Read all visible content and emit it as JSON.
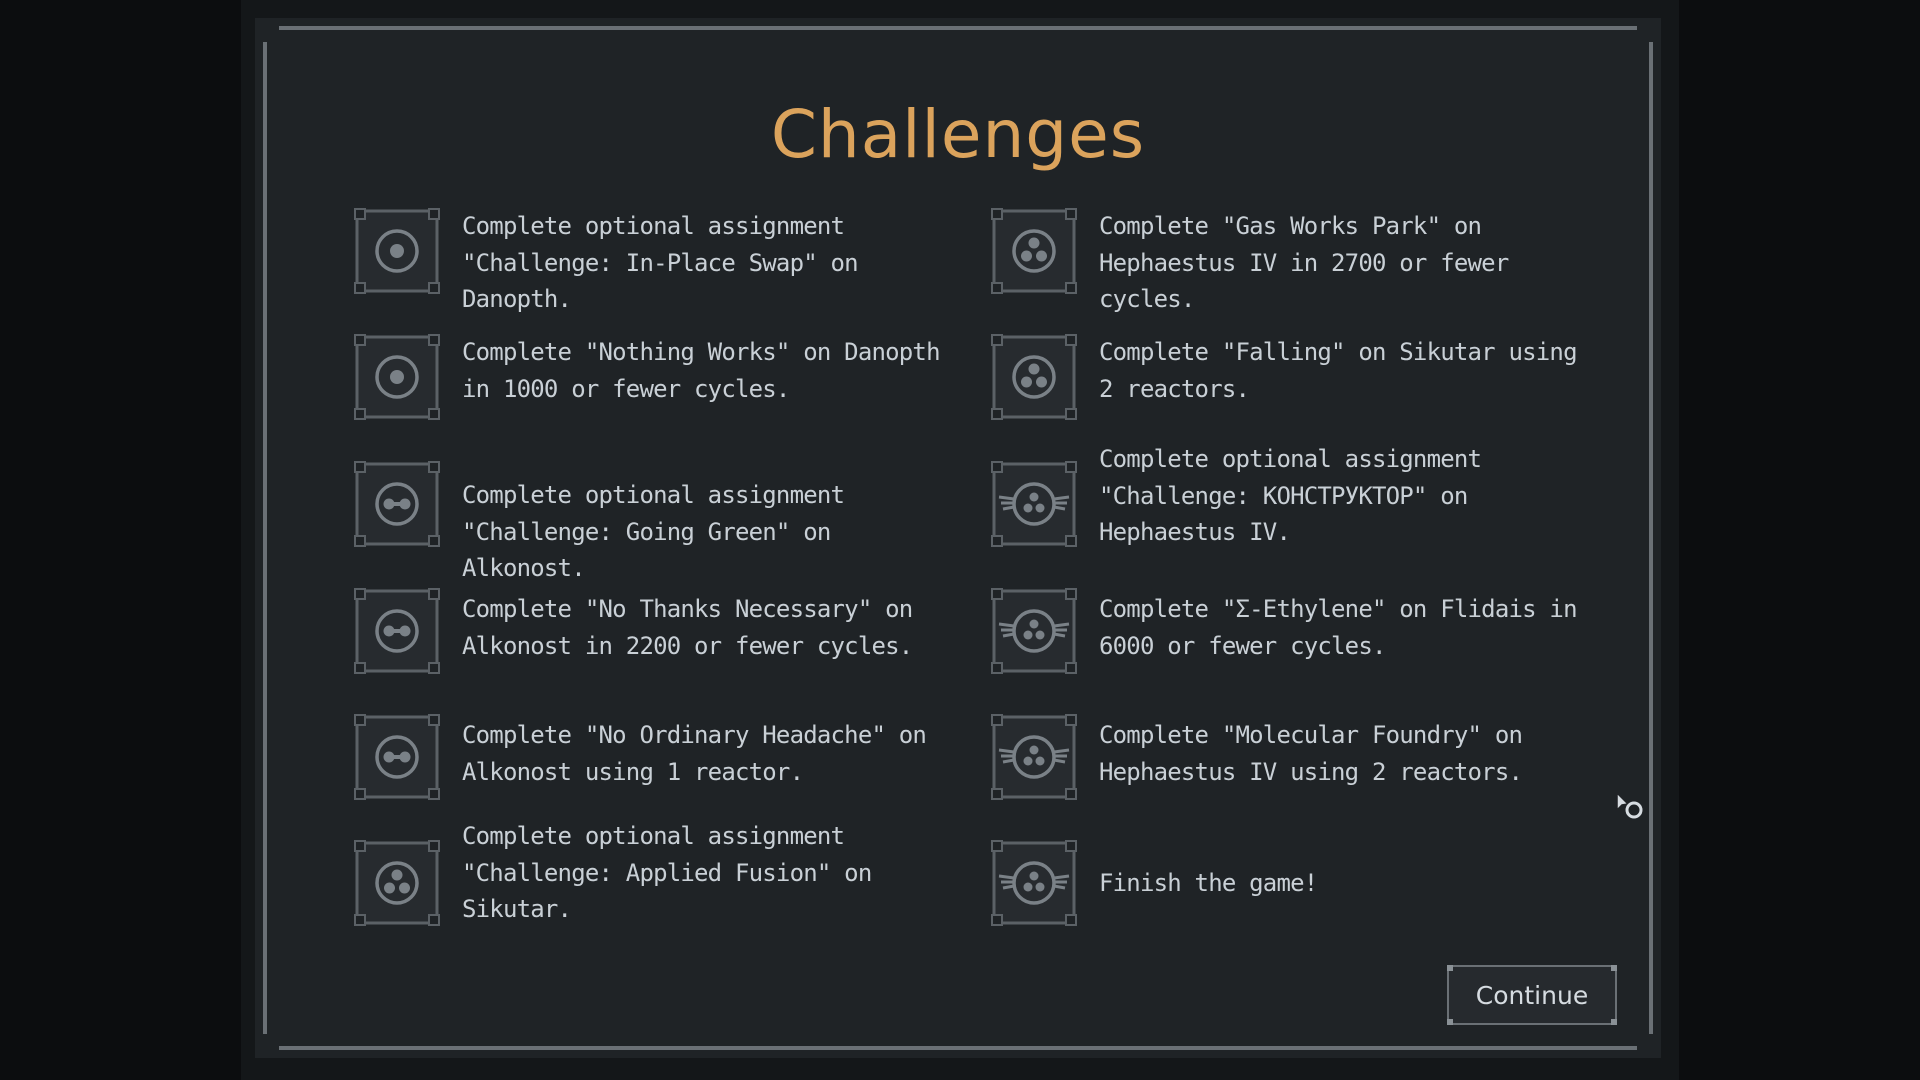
{
  "title": "Challenges",
  "colors": {
    "title": "#dba35c",
    "text": "#c9d0d6",
    "panel": "#1f2326",
    "border": "#6a7075"
  },
  "challenges": [
    {
      "icon": "dot-ring-icon",
      "text": "Complete optional assignment \"Challenge: In-Place Swap\" on Danopth."
    },
    {
      "icon": "dot-ring-icon",
      "text": "Complete \"Nothing Works\" on Danopth in 1000 or fewer cycles."
    },
    {
      "icon": "linked-ring-icon",
      "text": "Complete optional assignment \"Challenge: Going Green\" on Alkonost."
    },
    {
      "icon": "linked-ring-icon",
      "text": "Complete \"No Thanks Necessary\" on Alkonost in 2200 or fewer cycles."
    },
    {
      "icon": "linked-ring-icon",
      "text": "Complete \"No Ordinary Headache\" on Alkonost using 1 reactor."
    },
    {
      "icon": "trefoil-ring-icon",
      "text": "Complete optional assignment \"Challenge: Applied Fusion\" on Sikutar."
    },
    {
      "icon": "trefoil-ring-icon",
      "text": "Complete \"Gas Works Park\" on Hephaestus IV in 2700 or fewer cycles."
    },
    {
      "icon": "trefoil-ring-icon",
      "text": "Complete \"Falling\" on Sikutar using 2 reactors."
    },
    {
      "icon": "winged-trefoil-icon",
      "text": "Complete optional assignment \"Challenge: КОНСТРУКТОР\" on Hephaestus IV."
    },
    {
      "icon": "winged-trefoil-icon",
      "text": "Complete \"Σ-Ethylene\" on Flidais in 6000 or fewer cycles."
    },
    {
      "icon": "winged-trefoil-icon",
      "text": "Complete \"Molecular Foundry\" on Hephaestus IV using 2 reactors."
    },
    {
      "icon": "winged-trefoil-icon",
      "text": "Finish the game!"
    }
  ],
  "continue_label": "Continue"
}
